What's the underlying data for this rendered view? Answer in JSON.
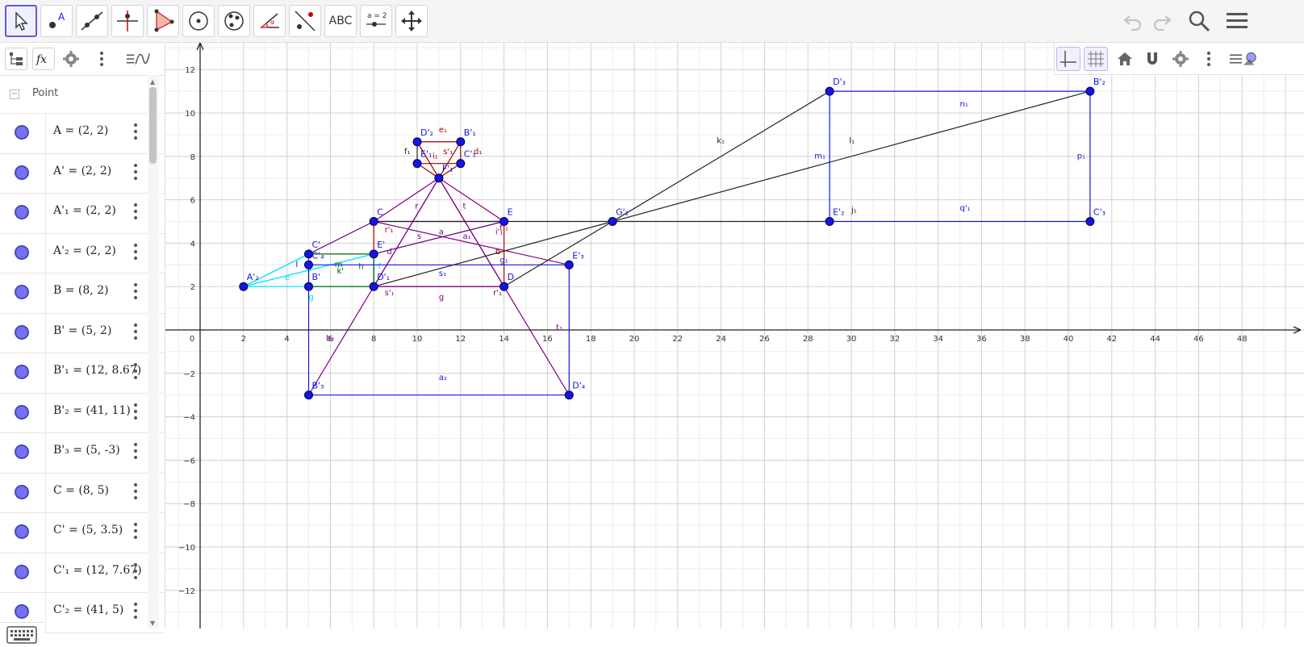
{
  "toolbar": {
    "tools": [
      {
        "name": "move-tool",
        "active": true
      },
      {
        "name": "point-tool",
        "letter": "A"
      },
      {
        "name": "line-tool"
      },
      {
        "name": "perpendicular-line-tool"
      },
      {
        "name": "polygon-tool"
      },
      {
        "name": "circle-tool"
      },
      {
        "name": "circle-through-points-tool"
      },
      {
        "name": "angle-tool",
        "letter": "α"
      },
      {
        "name": "reflect-tool"
      },
      {
        "name": "text-tool",
        "label": "ABC"
      },
      {
        "name": "slider-tool",
        "label": "a = 2"
      },
      {
        "name": "move-graphics-view-tool"
      }
    ]
  },
  "algebra": {
    "group_label": "Point",
    "collapse_symbol": "−",
    "rows": [
      {
        "def": "A = (2, 2)"
      },
      {
        "def": "A' = (2, 2)"
      },
      {
        "def": "A'₁ = (2, 2)"
      },
      {
        "def": "A'₂ = (2, 2)"
      },
      {
        "def": "B = (8, 2)"
      },
      {
        "def": "B' = (5, 2)"
      },
      {
        "def": "B'₁ = (12, 8.67)"
      },
      {
        "def": "B'₂ = (41, 11)"
      },
      {
        "def": "B'₃ = (5, -3)"
      },
      {
        "def": "C = (8, 5)"
      },
      {
        "def": "C' = (5, 3.5)"
      },
      {
        "def": "C'₁ = (12, 7.67)"
      },
      {
        "def": "C'₂ = (41, 5)"
      }
    ]
  },
  "graph": {
    "x_ticks": [
      "0",
      "2",
      "4",
      "6",
      "8",
      "10",
      "12",
      "14",
      "16",
      "18",
      "20",
      "22",
      "24",
      "26",
      "28",
      "30",
      "32",
      "34",
      "36",
      "38",
      "40",
      "42",
      "44",
      "46",
      "48"
    ],
    "y_ticks": [
      "12",
      "10",
      "8",
      "6",
      "4",
      "2",
      "−2",
      "−4",
      "−6",
      "−8",
      "−10",
      "−12"
    ],
    "colors": {
      "blue": "#1515e0",
      "purple": "#800080",
      "cyan": "#00e5ff",
      "black": "#222222",
      "red": "#b00000",
      "darkred": "#990000",
      "green": "#006400",
      "grid": "#d0d0d0",
      "axis": "#222222"
    },
    "points": [
      {
        "label": "C",
        "x": 8,
        "y": 5
      },
      {
        "label": "E",
        "x": 14,
        "y": 5
      },
      {
        "label": "D",
        "x": 14,
        "y": 2
      },
      {
        "label": "D'₁",
        "x": 8,
        "y": 2
      },
      {
        "label": "C'",
        "x": 5,
        "y": 3.5
      },
      {
        "label": "B'",
        "x": 5,
        "y": 2
      },
      {
        "label": "C'₄",
        "x": 5,
        "y": 3
      },
      {
        "label": "E'",
        "x": 8,
        "y": 3.5
      },
      {
        "label": "A'₂",
        "x": 2,
        "y": 2
      },
      {
        "label": "E'₃",
        "x": 17,
        "y": 3
      },
      {
        "label": "B'₃",
        "x": 5,
        "y": -3
      },
      {
        "label": "D'₄",
        "x": 17,
        "y": -3
      },
      {
        "label": "D'₂",
        "x": 10,
        "y": 8.67
      },
      {
        "label": "B'₁",
        "x": 12,
        "y": 8.67
      },
      {
        "label": "E'₁",
        "x": 10,
        "y": 7.67
      },
      {
        "label": "C'₁",
        "x": 12,
        "y": 7.67
      },
      {
        "label": "F'₁",
        "x": 11,
        "y": 7
      },
      {
        "label": "G'₂",
        "x": 19,
        "y": 5
      },
      {
        "label": "D'₃",
        "x": 29,
        "y": 11
      },
      {
        "label": "B'₂",
        "x": 41,
        "y": 11
      },
      {
        "label": "E'₂",
        "x": 29,
        "y": 5
      },
      {
        "label": "C'₃",
        "x": 41,
        "y": 5
      }
    ],
    "segments": [
      {
        "name": "a",
        "x1": 8,
        "y1": 5,
        "x2": 14,
        "y2": 5,
        "c": "purple",
        "lbl": "a",
        "lx": 11,
        "ly": 4.4
      },
      {
        "name": "b",
        "x1": 14,
        "y1": 5,
        "x2": 14,
        "y2": 2,
        "c": "red",
        "lbl": "b",
        "lx": 13.6,
        "ly": 3.5
      },
      {
        "name": "g",
        "x1": 14,
        "y1": 2,
        "x2": 8,
        "y2": 2,
        "c": "purple",
        "lbl": "g",
        "lx": 11,
        "ly": 1.4
      },
      {
        "name": "r1",
        "x1": 8,
        "y1": 2,
        "x2": 8,
        "y2": 5,
        "c": "red",
        "lbl": "r'₁",
        "lx": 8.5,
        "ly": 4.5
      },
      {
        "name": "cyan-top",
        "x1": 2,
        "y1": 2,
        "x2": 14,
        "y2": 5,
        "c": "cyan",
        "lbl": "",
        "lx": 0,
        "ly": 0
      },
      {
        "name": "cyan-2",
        "x1": 2,
        "y1": 2,
        "x2": 8,
        "y2": 5,
        "c": "cyan",
        "lbl": "",
        "lx": 0,
        "ly": 0
      },
      {
        "name": "cyan-3",
        "x1": 2,
        "y1": 2,
        "x2": 5,
        "y2": 3.5,
        "c": "cyan",
        "lbl": "e",
        "lx": 3.9,
        "ly": 2.3
      },
      {
        "name": "cyan-4",
        "x1": 2,
        "y1": 2,
        "x2": 8,
        "y2": 3.5,
        "c": "cyan",
        "lbl": "",
        "lx": 0,
        "ly": 0
      },
      {
        "name": "cyan-5",
        "x1": 2,
        "y1": 2,
        "x2": 8,
        "y2": 2,
        "c": "cyan",
        "lbl": "",
        "lx": 0,
        "ly": 0
      },
      {
        "name": "cyan-6",
        "x1": 8,
        "y1": 2,
        "x2": 8,
        "y2": 3.5,
        "c": "cyan",
        "lbl": "f",
        "lx": 8.2,
        "ly": 2.8
      },
      {
        "name": "cyan-g",
        "x1": 5,
        "y1": 2,
        "x2": 5,
        "y2": 1.5,
        "c": "cyan",
        "lbl": "g",
        "lx": 5,
        "ly": 1.4
      },
      {
        "name": "green-1",
        "x1": 5,
        "y1": 3.5,
        "x2": 8,
        "y2": 3.5,
        "c": "green",
        "lbl": "m",
        "lx": 6.2,
        "ly": 2.9
      },
      {
        "name": "green-2",
        "x1": 5,
        "y1": 2,
        "x2": 8,
        "y2": 2,
        "c": "green",
        "lbl": "k'",
        "lx": 6.3,
        "ly": 2.6
      },
      {
        "name": "green-3",
        "x1": 5,
        "y1": 2,
        "x2": 5,
        "y2": 3.5,
        "c": "green",
        "lbl": "",
        "lx": 0,
        "ly": 0
      },
      {
        "name": "green-4",
        "x1": 8,
        "y1": 3.5,
        "x2": 8,
        "y2": 2,
        "c": "green",
        "lbl": "h",
        "lx": 7.3,
        "ly": 2.8
      },
      {
        "name": "purple-c",
        "x1": 8,
        "y1": 5,
        "x2": 5,
        "y2": 3.5,
        "c": "purple",
        "lbl": "",
        "lx": 0,
        "ly": 0
      },
      {
        "name": "purple-e",
        "x1": 14,
        "y1": 5,
        "x2": 8,
        "y2": 3.5,
        "c": "purple",
        "lbl": "d",
        "lx": 8.6,
        "ly": 3.5
      },
      {
        "name": "purple-r",
        "x1": 11,
        "y1": 7,
        "x2": 8,
        "y2": 5,
        "c": "purple",
        "lbl": "r",
        "lx": 9.9,
        "ly": 5.6
      },
      {
        "name": "purple-t",
        "x1": 11,
        "y1": 7,
        "x2": 14,
        "y2": 5,
        "c": "purple",
        "lbl": "t",
        "lx": 12.1,
        "ly": 5.6
      },
      {
        "name": "purple-s",
        "x1": 11,
        "y1": 7,
        "x2": 8,
        "y2": 2,
        "c": "purple",
        "lbl": "s",
        "lx": 10,
        "ly": 4.2
      },
      {
        "name": "purple-a1",
        "x1": 11,
        "y1": 7,
        "x2": 14,
        "y2": 2,
        "c": "purple",
        "lbl": "a₁",
        "lx": 12.1,
        "ly": 4.2
      },
      {
        "name": "purple-i1",
        "x1": 8,
        "y1": 5,
        "x2": 17,
        "y2": 3,
        "c": "purple",
        "lbl": "i'₁",
        "lx": 13.6,
        "ly": 4.4
      },
      {
        "name": "purple-b2",
        "x1": 11,
        "y1": 7,
        "x2": 5,
        "y2": -3,
        "c": "purple",
        "lbl": "b₂",
        "lx": 5.8,
        "ly": -0.5
      },
      {
        "name": "purple-t1",
        "x1": 11,
        "y1": 7,
        "x2": 17,
        "y2": -3,
        "c": "purple",
        "lbl": "t₁",
        "lx": 16.4,
        "ly": 0
      },
      {
        "name": "purple-s1p",
        "x1": 8,
        "y1": 2,
        "x2": 14,
        "y2": 2,
        "c": "purple",
        "lbl": "s'₁",
        "lx": 8.5,
        "ly": 1.6
      },
      {
        "name": "purple-r1p",
        "x1": 14,
        "y1": 2,
        "x2": 14,
        "y2": 2,
        "c": "purple",
        "lbl": "r'₁",
        "lx": 13.5,
        "ly": 1.6
      },
      {
        "name": "red-t1",
        "x1": 14,
        "y1": 5,
        "x2": 14,
        "y2": 5,
        "c": "red",
        "lbl": "t'₁",
        "lx": 13.8,
        "ly": 4.6
      },
      {
        "name": "blue-s1",
        "x1": 5,
        "y1": 3,
        "x2": 17,
        "y2": 3,
        "c": "blue",
        "lbl": "s₁",
        "lx": 11,
        "ly": 2.5
      },
      {
        "name": "blue-left",
        "x1": 5,
        "y1": 3,
        "x2": 5,
        "y2": -3,
        "c": "blue",
        "lbl": "l",
        "lx": 4.4,
        "ly": 2.9
      },
      {
        "name": "blue-right",
        "x1": 17,
        "y1": 3,
        "x2": 17,
        "y2": -3,
        "c": "blue",
        "lbl": "",
        "lx": 0,
        "ly": 0
      },
      {
        "name": "blue-bottom",
        "x1": 5,
        "y1": -3,
        "x2": 17,
        "y2": -3,
        "c": "blue",
        "lbl": "a₂",
        "lx": 11,
        "ly": -2.3
      },
      {
        "name": "blue-g1",
        "x1": 14,
        "y1": 3,
        "x2": 14,
        "y2": 3,
        "c": "blue",
        "lbl": "g₁",
        "lx": 13.8,
        "ly": 3.1
      },
      {
        "name": "red-e1",
        "x1": 10,
        "y1": 8.67,
        "x2": 12,
        "y2": 8.67,
        "c": "darkred",
        "lbl": "e₁",
        "lx": 11,
        "ly": 9.1
      },
      {
        "name": "red-d1",
        "x1": 12,
        "y1": 8.67,
        "x2": 12,
        "y2": 7.67,
        "c": "darkred",
        "lbl": "d₁",
        "lx": 12.6,
        "ly": 8.1
      },
      {
        "name": "red-f1",
        "x1": 10,
        "y1": 8.67,
        "x2": 10,
        "y2": 7.67,
        "c": "black",
        "lbl": "f₁",
        "lx": 9.4,
        "ly": 8.1
      },
      {
        "name": "red-bottom",
        "x1": 10,
        "y1": 7.67,
        "x2": 12,
        "y2": 7.67,
        "c": "darkred",
        "lbl": "",
        "lx": 0,
        "ly": 0
      },
      {
        "name": "red-x1",
        "x1": 10,
        "y1": 7.67,
        "x2": 11,
        "y2": 7,
        "c": "darkred",
        "lbl": "i₁",
        "lx": 10.7,
        "ly": 7.9
      },
      {
        "name": "red-x2",
        "x1": 12,
        "y1": 7.67,
        "x2": 11,
        "y2": 7,
        "c": "darkred",
        "lbl": "",
        "lx": 0,
        "ly": 0
      },
      {
        "name": "red-x3",
        "x1": 10,
        "y1": 8.67,
        "x2": 11,
        "y2": 7,
        "c": "darkred",
        "lbl": "s'₁",
        "lx": 11.2,
        "ly": 8.1
      },
      {
        "name": "red-x4",
        "x1": 12,
        "y1": 8.67,
        "x2": 11,
        "y2": 7,
        "c": "darkred",
        "lbl": "",
        "lx": 0,
        "ly": 0
      },
      {
        "name": "black-c-g2",
        "x1": 8,
        "y1": 5,
        "x2": 19,
        "y2": 5,
        "c": "black",
        "lbl": "",
        "lx": 0,
        "ly": 0
      },
      {
        "name": "black-d1-g2",
        "x1": 8,
        "y1": 2,
        "x2": 19,
        "y2": 5,
        "c": "black",
        "lbl": "",
        "lx": 0,
        "ly": 0
      },
      {
        "name": "black-d-g2",
        "x1": 14,
        "y1": 2,
        "x2": 19,
        "y2": 5,
        "c": "black",
        "lbl": "",
        "lx": 0,
        "ly": 0
      },
      {
        "name": "black-k1",
        "x1": 19,
        "y1": 5,
        "x2": 29,
        "y2": 11,
        "c": "black",
        "lbl": "k₁",
        "lx": 23.8,
        "ly": 8.6
      },
      {
        "name": "black-l1",
        "x1": 19,
        "y1": 5,
        "x2": 41,
        "y2": 11,
        "c": "black",
        "lbl": "l₁",
        "lx": 29.9,
        "ly": 8.6
      },
      {
        "name": "black-j1",
        "x1": 19,
        "y1": 5,
        "x2": 29,
        "y2": 5,
        "c": "black",
        "lbl": "j₁",
        "lx": 30,
        "ly": 5.4
      },
      {
        "name": "blue-n1",
        "x1": 29,
        "y1": 11,
        "x2": 41,
        "y2": 11,
        "c": "blue",
        "lbl": "n₁",
        "lx": 35,
        "ly": 10.3
      },
      {
        "name": "blue-m1",
        "x1": 29,
        "y1": 11,
        "x2": 29,
        "y2": 5,
        "c": "blue",
        "lbl": "m₁",
        "lx": 28.3,
        "ly": 7.9
      },
      {
        "name": "blue-p1",
        "x1": 41,
        "y1": 11,
        "x2": 41,
        "y2": 5,
        "c": "blue",
        "lbl": "p₁",
        "lx": 40.4,
        "ly": 7.9
      },
      {
        "name": "blue-q1",
        "x1": 29,
        "y1": 5,
        "x2": 41,
        "y2": 5,
        "c": "blue",
        "lbl": "q'₁",
        "lx": 35,
        "ly": 5.5
      }
    ]
  }
}
